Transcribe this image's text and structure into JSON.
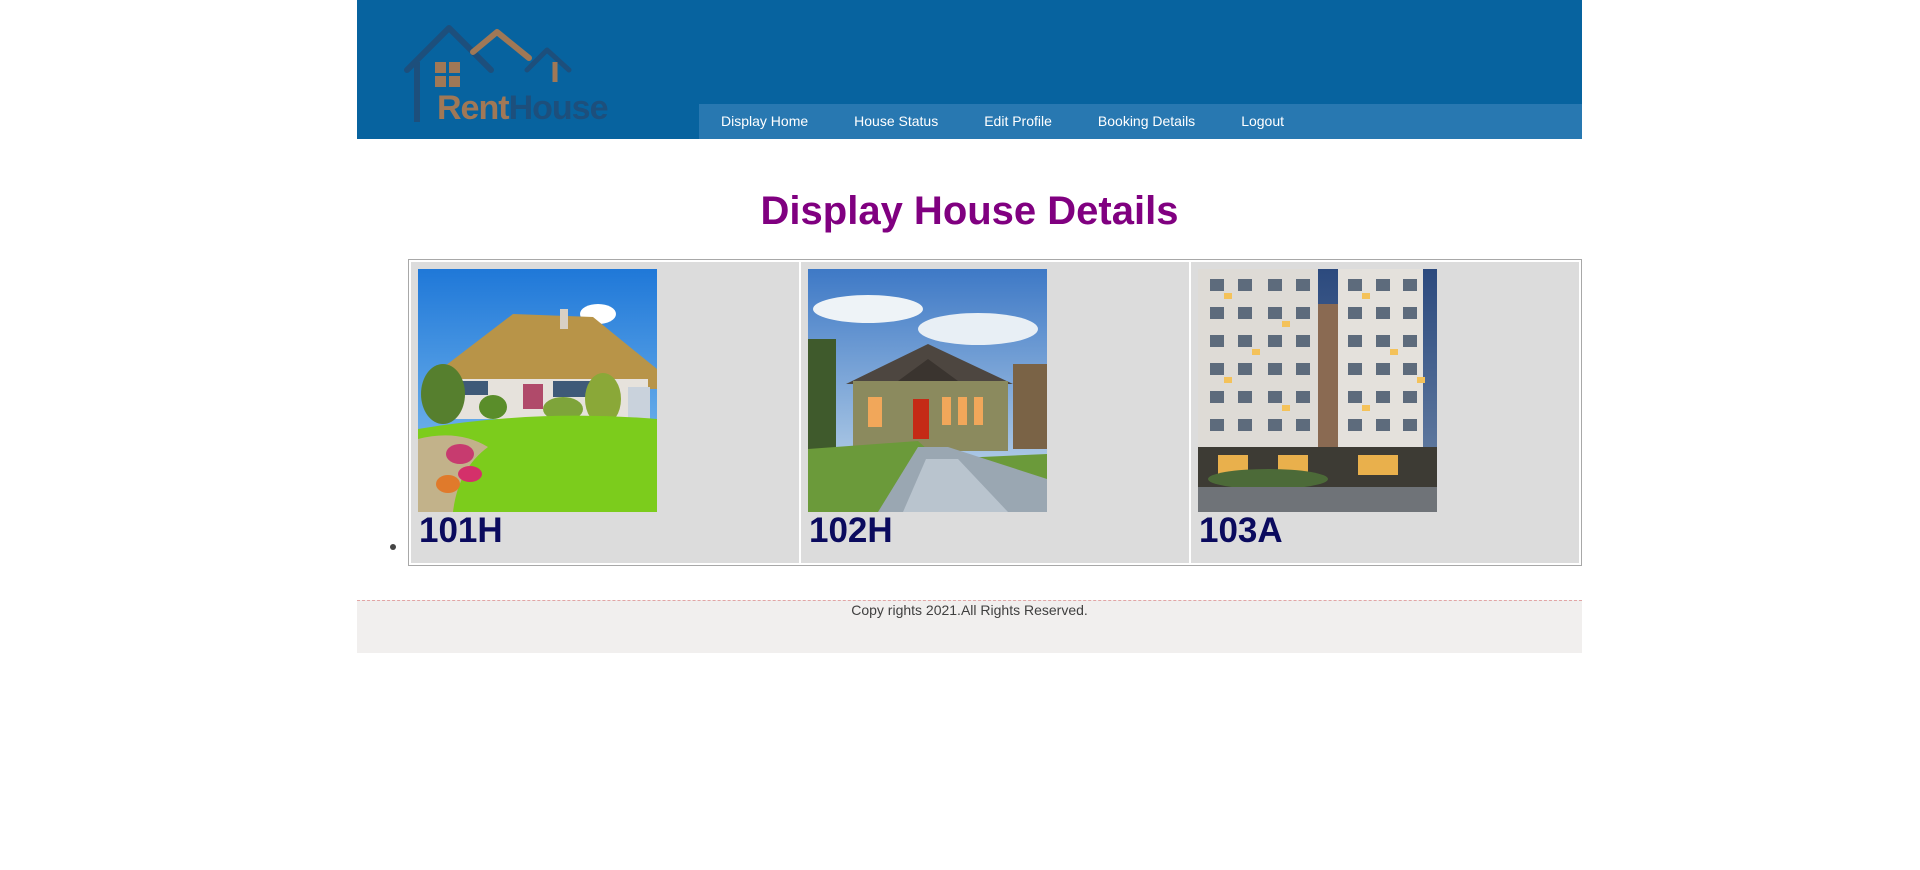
{
  "brand": {
    "logo_text_part1": "Rent",
    "logo_text_part2": "House"
  },
  "nav": {
    "items": [
      {
        "label": "Display Home"
      },
      {
        "label": "House Status"
      },
      {
        "label": "Edit Profile"
      },
      {
        "label": "Booking Details"
      },
      {
        "label": "Logout"
      }
    ]
  },
  "main": {
    "title": "Display House Details",
    "houses": [
      {
        "id": "101H",
        "image": "house-photo-101H"
      },
      {
        "id": "102H",
        "image": "house-photo-102H"
      },
      {
        "id": "103A",
        "image": "apartment-photo-103A"
      }
    ]
  },
  "footer": {
    "text": "Copy rights 2021.All Rights Reserved."
  },
  "colors": {
    "header_bg": "#07639f",
    "nav_bg": "#2878b1",
    "title": "#800080",
    "house_id": "#0b0b5e",
    "footer_bg": "#f1efee"
  }
}
